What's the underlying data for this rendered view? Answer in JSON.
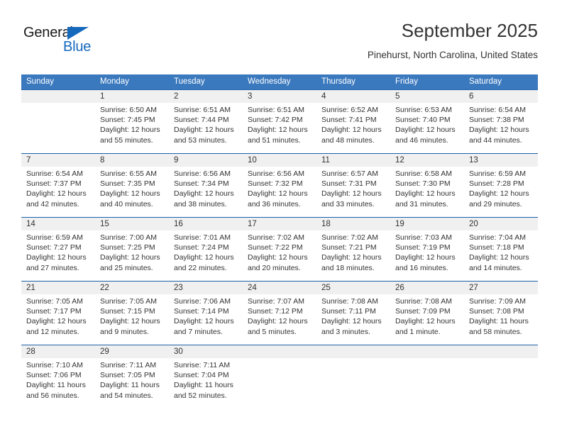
{
  "logo": {
    "word1": "General",
    "word2": "Blue",
    "triangle_color": "#1569bd"
  },
  "header": {
    "title": "September 2025",
    "subtitle": "Pinehurst, North Carolina, United States"
  },
  "colors": {
    "header_bar": "#3b79be",
    "week_separator": "#1a5fa8",
    "daynum_band": "#f0f0f0",
    "text": "#333333"
  },
  "weekdays": [
    "Sunday",
    "Monday",
    "Tuesday",
    "Wednesday",
    "Thursday",
    "Friday",
    "Saturday"
  ],
  "weeks": [
    {
      "days": [
        {
          "num": "",
          "sunrise": "",
          "sunset": "",
          "daylight1": "",
          "daylight2": ""
        },
        {
          "num": "1",
          "sunrise": "Sunrise: 6:50 AM",
          "sunset": "Sunset: 7:45 PM",
          "daylight1": "Daylight: 12 hours",
          "daylight2": "and 55 minutes."
        },
        {
          "num": "2",
          "sunrise": "Sunrise: 6:51 AM",
          "sunset": "Sunset: 7:44 PM",
          "daylight1": "Daylight: 12 hours",
          "daylight2": "and 53 minutes."
        },
        {
          "num": "3",
          "sunrise": "Sunrise: 6:51 AM",
          "sunset": "Sunset: 7:42 PM",
          "daylight1": "Daylight: 12 hours",
          "daylight2": "and 51 minutes."
        },
        {
          "num": "4",
          "sunrise": "Sunrise: 6:52 AM",
          "sunset": "Sunset: 7:41 PM",
          "daylight1": "Daylight: 12 hours",
          "daylight2": "and 48 minutes."
        },
        {
          "num": "5",
          "sunrise": "Sunrise: 6:53 AM",
          "sunset": "Sunset: 7:40 PM",
          "daylight1": "Daylight: 12 hours",
          "daylight2": "and 46 minutes."
        },
        {
          "num": "6",
          "sunrise": "Sunrise: 6:54 AM",
          "sunset": "Sunset: 7:38 PM",
          "daylight1": "Daylight: 12 hours",
          "daylight2": "and 44 minutes."
        }
      ]
    },
    {
      "days": [
        {
          "num": "7",
          "sunrise": "Sunrise: 6:54 AM",
          "sunset": "Sunset: 7:37 PM",
          "daylight1": "Daylight: 12 hours",
          "daylight2": "and 42 minutes."
        },
        {
          "num": "8",
          "sunrise": "Sunrise: 6:55 AM",
          "sunset": "Sunset: 7:35 PM",
          "daylight1": "Daylight: 12 hours",
          "daylight2": "and 40 minutes."
        },
        {
          "num": "9",
          "sunrise": "Sunrise: 6:56 AM",
          "sunset": "Sunset: 7:34 PM",
          "daylight1": "Daylight: 12 hours",
          "daylight2": "and 38 minutes."
        },
        {
          "num": "10",
          "sunrise": "Sunrise: 6:56 AM",
          "sunset": "Sunset: 7:32 PM",
          "daylight1": "Daylight: 12 hours",
          "daylight2": "and 36 minutes."
        },
        {
          "num": "11",
          "sunrise": "Sunrise: 6:57 AM",
          "sunset": "Sunset: 7:31 PM",
          "daylight1": "Daylight: 12 hours",
          "daylight2": "and 33 minutes."
        },
        {
          "num": "12",
          "sunrise": "Sunrise: 6:58 AM",
          "sunset": "Sunset: 7:30 PM",
          "daylight1": "Daylight: 12 hours",
          "daylight2": "and 31 minutes."
        },
        {
          "num": "13",
          "sunrise": "Sunrise: 6:59 AM",
          "sunset": "Sunset: 7:28 PM",
          "daylight1": "Daylight: 12 hours",
          "daylight2": "and 29 minutes."
        }
      ]
    },
    {
      "days": [
        {
          "num": "14",
          "sunrise": "Sunrise: 6:59 AM",
          "sunset": "Sunset: 7:27 PM",
          "daylight1": "Daylight: 12 hours",
          "daylight2": "and 27 minutes."
        },
        {
          "num": "15",
          "sunrise": "Sunrise: 7:00 AM",
          "sunset": "Sunset: 7:25 PM",
          "daylight1": "Daylight: 12 hours",
          "daylight2": "and 25 minutes."
        },
        {
          "num": "16",
          "sunrise": "Sunrise: 7:01 AM",
          "sunset": "Sunset: 7:24 PM",
          "daylight1": "Daylight: 12 hours",
          "daylight2": "and 22 minutes."
        },
        {
          "num": "17",
          "sunrise": "Sunrise: 7:02 AM",
          "sunset": "Sunset: 7:22 PM",
          "daylight1": "Daylight: 12 hours",
          "daylight2": "and 20 minutes."
        },
        {
          "num": "18",
          "sunrise": "Sunrise: 7:02 AM",
          "sunset": "Sunset: 7:21 PM",
          "daylight1": "Daylight: 12 hours",
          "daylight2": "and 18 minutes."
        },
        {
          "num": "19",
          "sunrise": "Sunrise: 7:03 AM",
          "sunset": "Sunset: 7:19 PM",
          "daylight1": "Daylight: 12 hours",
          "daylight2": "and 16 minutes."
        },
        {
          "num": "20",
          "sunrise": "Sunrise: 7:04 AM",
          "sunset": "Sunset: 7:18 PM",
          "daylight1": "Daylight: 12 hours",
          "daylight2": "and 14 minutes."
        }
      ]
    },
    {
      "days": [
        {
          "num": "21",
          "sunrise": "Sunrise: 7:05 AM",
          "sunset": "Sunset: 7:17 PM",
          "daylight1": "Daylight: 12 hours",
          "daylight2": "and 12 minutes."
        },
        {
          "num": "22",
          "sunrise": "Sunrise: 7:05 AM",
          "sunset": "Sunset: 7:15 PM",
          "daylight1": "Daylight: 12 hours",
          "daylight2": "and 9 minutes."
        },
        {
          "num": "23",
          "sunrise": "Sunrise: 7:06 AM",
          "sunset": "Sunset: 7:14 PM",
          "daylight1": "Daylight: 12 hours",
          "daylight2": "and 7 minutes."
        },
        {
          "num": "24",
          "sunrise": "Sunrise: 7:07 AM",
          "sunset": "Sunset: 7:12 PM",
          "daylight1": "Daylight: 12 hours",
          "daylight2": "and 5 minutes."
        },
        {
          "num": "25",
          "sunrise": "Sunrise: 7:08 AM",
          "sunset": "Sunset: 7:11 PM",
          "daylight1": "Daylight: 12 hours",
          "daylight2": "and 3 minutes."
        },
        {
          "num": "26",
          "sunrise": "Sunrise: 7:08 AM",
          "sunset": "Sunset: 7:09 PM",
          "daylight1": "Daylight: 12 hours",
          "daylight2": "and 1 minute."
        },
        {
          "num": "27",
          "sunrise": "Sunrise: 7:09 AM",
          "sunset": "Sunset: 7:08 PM",
          "daylight1": "Daylight: 11 hours",
          "daylight2": "and 58 minutes."
        }
      ]
    },
    {
      "days": [
        {
          "num": "28",
          "sunrise": "Sunrise: 7:10 AM",
          "sunset": "Sunset: 7:06 PM",
          "daylight1": "Daylight: 11 hours",
          "daylight2": "and 56 minutes."
        },
        {
          "num": "29",
          "sunrise": "Sunrise: 7:11 AM",
          "sunset": "Sunset: 7:05 PM",
          "daylight1": "Daylight: 11 hours",
          "daylight2": "and 54 minutes."
        },
        {
          "num": "30",
          "sunrise": "Sunrise: 7:11 AM",
          "sunset": "Sunset: 7:04 PM",
          "daylight1": "Daylight: 11 hours",
          "daylight2": "and 52 minutes."
        },
        {
          "num": "",
          "sunrise": "",
          "sunset": "",
          "daylight1": "",
          "daylight2": ""
        },
        {
          "num": "",
          "sunrise": "",
          "sunset": "",
          "daylight1": "",
          "daylight2": ""
        },
        {
          "num": "",
          "sunrise": "",
          "sunset": "",
          "daylight1": "",
          "daylight2": ""
        },
        {
          "num": "",
          "sunrise": "",
          "sunset": "",
          "daylight1": "",
          "daylight2": ""
        }
      ]
    }
  ]
}
